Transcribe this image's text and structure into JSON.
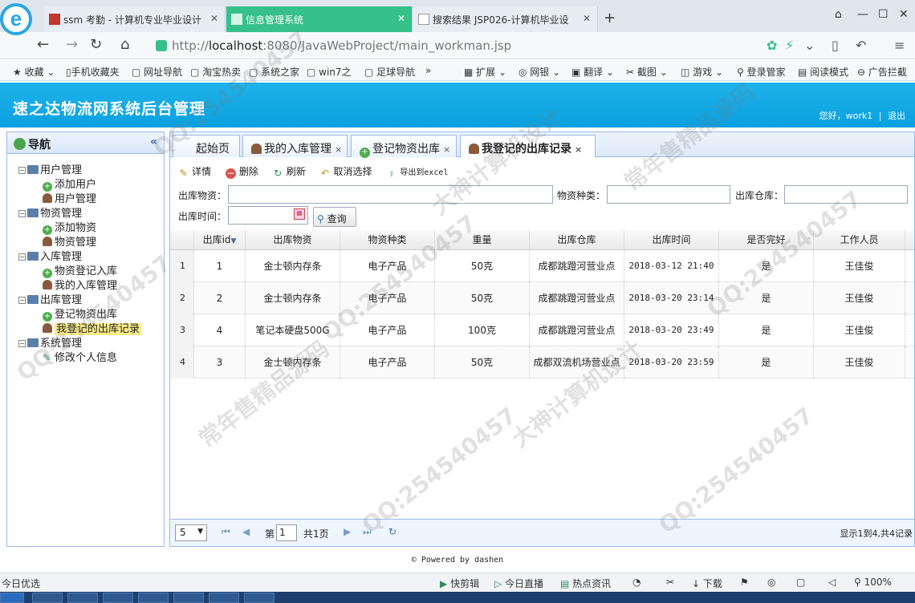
{
  "browser": {
    "tabs": [
      {
        "label": "ssm 考勤 - 计算机专业毕业设计"
      },
      {
        "label": "信息管理系统"
      },
      {
        "label": "搜索结果 JSP026-计算机毕业设"
      }
    ],
    "url_prefix": "http://",
    "url_host": "localhost",
    "url_rest": ":8080/JavaWebProject/main_workman.jsp",
    "bookmarks": [
      "收藏",
      "手机收藏夹",
      "网址导航",
      "淘宝热卖",
      "系统之家",
      "win7之",
      "足球导航",
      "»",
      "扩展",
      "网银",
      "翻译",
      "截图",
      "游戏",
      "登录管家",
      "阅读模式",
      "广告拦截"
    ],
    "accent": "#36c08a"
  },
  "app": {
    "title": "速之达物流网系统后台管理",
    "greeting": "您好，work1",
    "separator": "|",
    "logout": "退出",
    "header_color": "#0aa0df"
  },
  "sidebar": {
    "title": "导航",
    "collapse": "«",
    "groups": [
      {
        "label": "用户管理",
        "items": [
          "添加用户",
          "用户管理"
        ]
      },
      {
        "label": "物资管理",
        "items": [
          "添加物资",
          "物资管理"
        ]
      },
      {
        "label": "入库管理",
        "items": [
          "物资登记入库",
          "我的入库管理"
        ]
      },
      {
        "label": "出库管理",
        "items": [
          "登记物资出库",
          "我登记的出库记录"
        ]
      },
      {
        "label": "系统管理",
        "items": [
          "修改个人信息"
        ]
      }
    ]
  },
  "main_tabs": [
    {
      "label": "起始页"
    },
    {
      "label": "我的入库管理",
      "close": "×"
    },
    {
      "label": "登记物资出库",
      "close": "×"
    },
    {
      "label": "我登记的出库记录",
      "close": "×"
    }
  ],
  "toolbar": {
    "detail": "详情",
    "delete": "删除",
    "refresh": "刷新",
    "cancel_select": "取消选择",
    "export": "导出到excel"
  },
  "search": {
    "goods_label": "出库物资：",
    "type_label": "物资种类：",
    "warehouse_label": "出库仓库：",
    "time_label": "出库时间：",
    "query_button": "查询",
    "goods_value": "",
    "type_value": "",
    "warehouse_value": "",
    "time_value": ""
  },
  "grid": {
    "columns": [
      "出库id",
      "出库物资",
      "物资种类",
      "重量",
      "出库仓库",
      "出库时间",
      "是否完好",
      "工作人员"
    ],
    "sort_arrow": "▼",
    "rows": [
      {
        "rn": "1",
        "id": "1",
        "goods": "金士顿内存条",
        "type": "电子产品",
        "weight": "50克",
        "warehouse": "成都跳蹬河营业点",
        "time": "2018-03-12 21:40",
        "ok": "是",
        "staff": "王佳俊"
      },
      {
        "rn": "2",
        "id": "2",
        "goods": "金士顿内存条",
        "type": "电子产品",
        "weight": "50克",
        "warehouse": "成都跳蹬河营业点",
        "time": "2018-03-20 23:14",
        "ok": "是",
        "staff": "王佳俊"
      },
      {
        "rn": "3",
        "id": "4",
        "goods": "笔记本硬盘500G",
        "type": "电子产品",
        "weight": "100克",
        "warehouse": "成都跳蹬河营业点",
        "time": "2018-03-20 23:49",
        "ok": "是",
        "staff": "王佳俊"
      },
      {
        "rn": "4",
        "id": "3",
        "goods": "金士顿内存条",
        "type": "电子产品",
        "weight": "50克",
        "warehouse": "成都双流机场营业点",
        "time": "2018-03-20 23:59",
        "ok": "是",
        "staff": "王佳俊"
      }
    ]
  },
  "pager": {
    "page_size": "5",
    "page_prefix": "第",
    "page_value": "1",
    "page_suffix": "共1页",
    "summary": "显示1到4,共4记录"
  },
  "footer": "© Powered by dashen",
  "statusbar": {
    "left": "今日优选",
    "items": [
      "快剪辑",
      "今日直播",
      "热点资讯",
      "下载",
      "100%"
    ]
  },
  "watermarks": [
    "QQ:254540457",
    "大神计算机设计",
    "常年售精品源码"
  ]
}
